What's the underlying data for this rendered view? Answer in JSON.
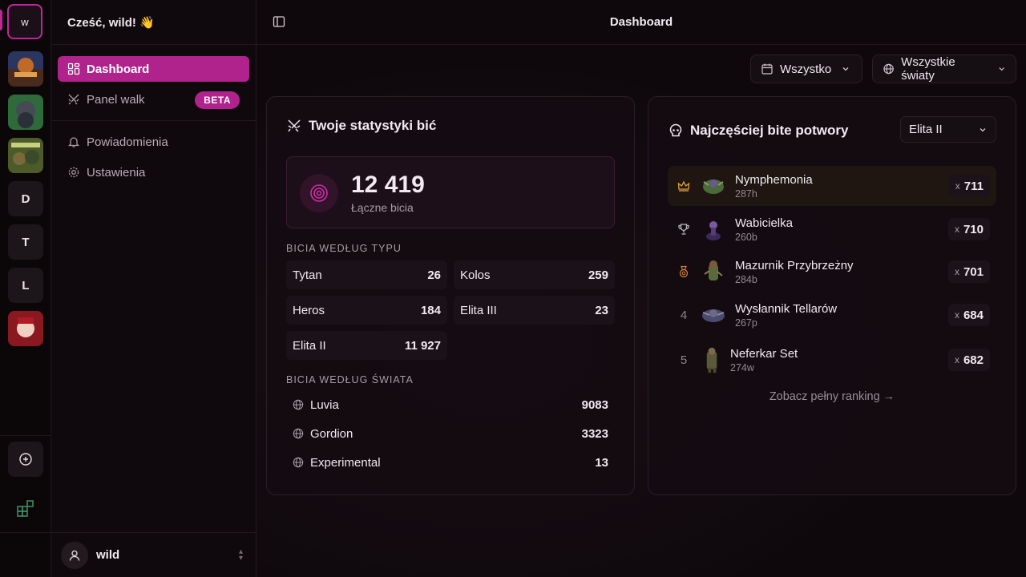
{
  "rail": {
    "active_initial": "w",
    "servers": [
      "D",
      "T",
      "L"
    ]
  },
  "sidebar": {
    "greeting": "Cześć, wild! 👋",
    "items": [
      {
        "label": "Dashboard",
        "icon": "dashboard-icon"
      },
      {
        "label": "Panel walk",
        "icon": "swords-icon",
        "badge": "BETA"
      },
      {
        "label": "Powiadomienia",
        "icon": "bell-icon"
      },
      {
        "label": "Ustawienia",
        "icon": "gear-icon"
      }
    ],
    "user": "wild"
  },
  "header": {
    "title": "Dashboard"
  },
  "filters": {
    "time": "Wszystko",
    "world": "Wszystkie światy"
  },
  "stats": {
    "title": "Twoje statystyki bić",
    "total": "12 419",
    "total_label": "Łączne bicia",
    "by_type_label": "BICIA WEDŁUG TYPU",
    "by_type": [
      {
        "name": "Tytan",
        "value": "26"
      },
      {
        "name": "Kolos",
        "value": "259"
      },
      {
        "name": "Heros",
        "value": "184"
      },
      {
        "name": "Elita III",
        "value": "23"
      },
      {
        "name": "Elita II",
        "value": "11 927"
      }
    ],
    "by_world_label": "BICIA WEDŁUG ŚWIATA",
    "by_world": [
      {
        "name": "Luvia",
        "value": "9083"
      },
      {
        "name": "Gordion",
        "value": "3323"
      },
      {
        "name": "Experimental",
        "value": "13"
      }
    ]
  },
  "ranking": {
    "title": "Najczęściej bite potwory",
    "selected": "Elita II",
    "rows": [
      {
        "pos": "1",
        "name": "Nymphemonia",
        "level": "287h",
        "count": "711"
      },
      {
        "pos": "2",
        "name": "Wabicielka",
        "level": "260b",
        "count": "710"
      },
      {
        "pos": "3",
        "name": "Mazurnik Przybrzeżny",
        "level": "284b",
        "count": "701"
      },
      {
        "pos": "4",
        "name": "Wysłannik Tellarów",
        "level": "267p",
        "count": "684"
      },
      {
        "pos": "5",
        "name": "Neferkar Set",
        "level": "274w",
        "count": "682"
      }
    ],
    "count_prefix": "x",
    "see_all": "Zobacz pełny ranking →"
  },
  "colors": {
    "accent": "#b1238c",
    "gold": "#e0a43a",
    "silver": "#b9b9c2",
    "bronze": "#d07a3a"
  }
}
